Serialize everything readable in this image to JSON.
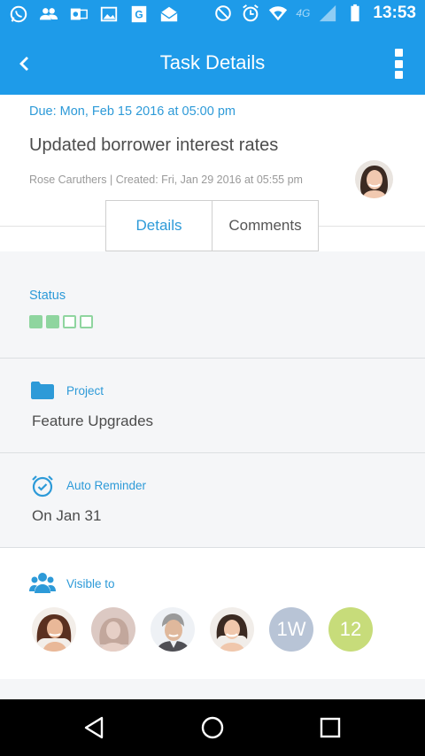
{
  "status_bar": {
    "time": "13:53",
    "network": "4G",
    "left_icons": [
      "whatsapp-icon",
      "people-icon",
      "outlook-icon",
      "gallery-icon",
      "google-drive-icon",
      "mail-icon"
    ],
    "right_icons": [
      "do-not-disturb-icon",
      "alarm-icon",
      "wifi-icon",
      "signal-icon",
      "battery-icon"
    ]
  },
  "app_bar": {
    "title": "Task Details",
    "back_icon": "chevron-left-icon",
    "menu_icon": "more-vert-icon"
  },
  "task": {
    "due": "Due: Mon, Feb 15 2016 at 05:00 pm",
    "title": "Updated borrower interest rates",
    "meta": "Rose Caruthers | Created: Fri, Jan 29 2016 at 05:55 pm"
  },
  "tabs": [
    {
      "label": "Details",
      "active": true
    },
    {
      "label": "Comments",
      "active": false
    }
  ],
  "status": {
    "label": "Status",
    "progress_filled": 2,
    "progress_total": 4
  },
  "project": {
    "label": "Project",
    "value": "Feature Upgrades"
  },
  "reminder": {
    "label": "Auto Reminder",
    "value": "On Jan 31"
  },
  "visible_to": {
    "label": "Visible to",
    "avatars": [
      "avatar-1",
      "avatar-2",
      "avatar-3",
      "avatar-4"
    ],
    "initials_badge": "1W",
    "count_badge": "12"
  },
  "colors": {
    "accent": "#1e9be9",
    "link": "#2d9ad8",
    "progress": "#8fd59f",
    "badge_initials": "#b8c4d6",
    "badge_count": "#c7dc7a"
  }
}
